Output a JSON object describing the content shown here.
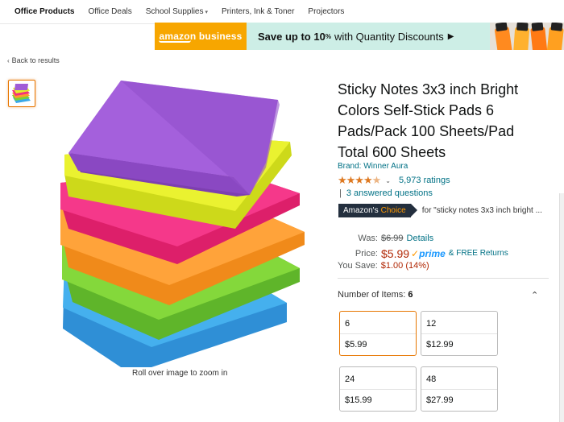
{
  "topnav": {
    "items": [
      {
        "label": "Office Products"
      },
      {
        "label": "Office Deals"
      },
      {
        "label": "School Supplies"
      },
      {
        "label": "Printers, Ink & Toner"
      },
      {
        "label": "Projectors"
      }
    ]
  },
  "banner": {
    "logo": "amazon business",
    "save_up": "Save up to 10",
    "pct": "%",
    "with": "with Quantity Discounts",
    "arrow": "▶"
  },
  "back_link": "Back to results",
  "product": {
    "title": "Sticky Notes 3x3 inch Bright Colors Self-Stick Pads 6 Pads/Pack 100 Sheets/Pad Total 600 Sheets",
    "brand": "Brand: Winner Aura",
    "stars": "★★★★",
    "half_star": "★",
    "rating_value": 4.5,
    "ratings_count": "5,973 ratings",
    "answered": "3 answered questions",
    "choice_prefix": "Amazon's",
    "choice_word": "Choice",
    "choice_for": "for \"sticky notes 3x3 inch bright ...",
    "zoom_hint": "Roll over image to zoom in"
  },
  "price": {
    "was_label": "Was:",
    "was_value": "$6.99",
    "details": "Details",
    "price_label": "Price:",
    "price_value": "$5.99",
    "prime_check": "✓",
    "prime": "prime",
    "free_returns": "& FREE Returns",
    "save_label": "You Save:",
    "save_value": "$1.00 (14%)"
  },
  "items": {
    "label": "Number of Items:",
    "selected": "6",
    "options": [
      {
        "qty": "6",
        "price": "$5.99"
      },
      {
        "qty": "12",
        "price": "$12.99"
      },
      {
        "qty": "24",
        "price": "$15.99"
      },
      {
        "qty": "48",
        "price": "$27.99"
      }
    ]
  },
  "colors": {
    "accent_orange": "#e77600",
    "link_teal": "#007185",
    "price_red": "#b12704",
    "star_orange": "#de7921",
    "note_purple": "#a05cd6",
    "note_yellow": "#e6f028",
    "note_pink": "#f2307e",
    "note_orange": "#ff9a2e",
    "note_green": "#7bd234",
    "note_blue": "#3aa8e8"
  },
  "icons": {
    "back": "chevron-left-icon",
    "dropdown": "chevron-down-icon",
    "collapse": "chevron-up-icon"
  }
}
